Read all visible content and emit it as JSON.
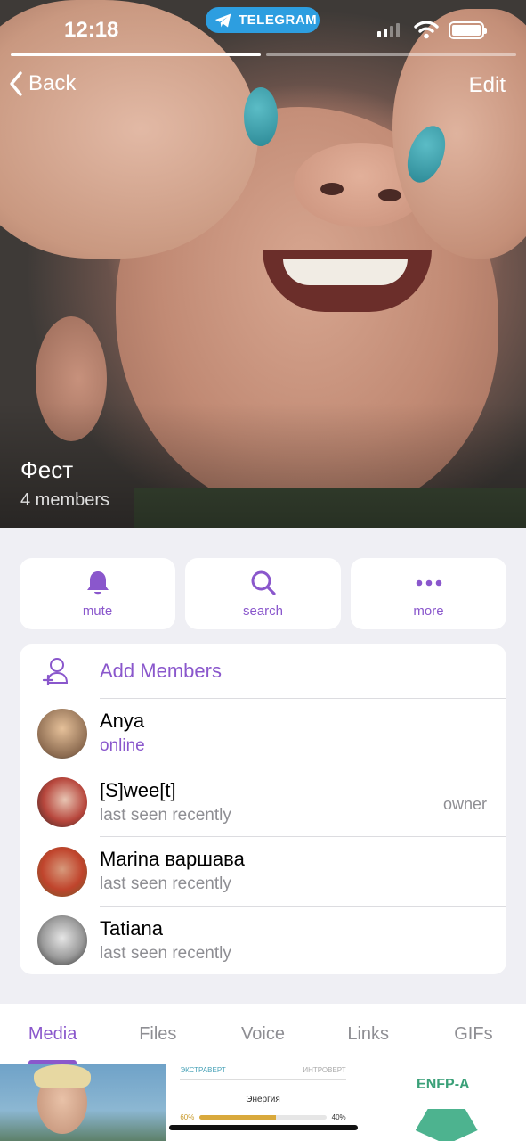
{
  "status_bar": {
    "time": "12:18",
    "app_pill": "TELEGRAM"
  },
  "story_progress": [
    1.0,
    0.0
  ],
  "nav": {
    "back_label": "Back",
    "edit_label": "Edit"
  },
  "chat": {
    "title": "Фест",
    "subtitle": "4 members"
  },
  "actions": [
    {
      "label": "mute",
      "icon": "bell-icon"
    },
    {
      "label": "search",
      "icon": "search-icon"
    },
    {
      "label": "more",
      "icon": "more-dots-icon"
    }
  ],
  "add_members_label": "Add Members",
  "members": [
    {
      "name": "Anya",
      "status": "online",
      "role": ""
    },
    {
      "name": "[S]wee[t]",
      "status": "last seen recently",
      "role": "owner"
    },
    {
      "name": "Marina варшава",
      "status": "last seen recently",
      "role": ""
    },
    {
      "name": "Tatiana",
      "status": "last seen recently",
      "role": ""
    }
  ],
  "tabs": [
    "Media",
    "Files",
    "Voice",
    "Links",
    "GIFs"
  ],
  "active_tab": "Media",
  "media_preview": {
    "tile2": {
      "left_label": "ЭКСТРАВЕРТ",
      "right_label": "ИНТРОВЕРТ",
      "trait": "Энергия",
      "left_pct": "60%",
      "right_pct": "40%",
      "fill": 0.6
    },
    "tile3": {
      "type_label": "ENFP-A"
    }
  },
  "colors": {
    "accent": "#8a57cc",
    "telegram_blue": "#2d9ee0",
    "background": "#efeff4"
  }
}
